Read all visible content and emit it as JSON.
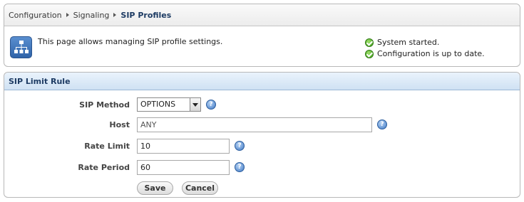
{
  "breadcrumb": {
    "items": [
      "Configuration",
      "Signaling",
      "SIP Profiles"
    ]
  },
  "info": {
    "description": "This page allows managing SIP profile settings.",
    "statuses": [
      "System started.",
      "Configuration is up to date."
    ]
  },
  "icons": {
    "app": "network-hierarchy-icon",
    "status": "check-circle-icon",
    "help": "help-icon",
    "select": "chevron-down-icon"
  },
  "form": {
    "title": "SIP Limit Rule",
    "fields": {
      "sip_method": {
        "label": "SIP Method",
        "value": "OPTIONS",
        "help": "?"
      },
      "host": {
        "label": "Host",
        "value": "ANY",
        "help": "?"
      },
      "rate_limit": {
        "label": "Rate Limit",
        "value": "10",
        "help": "?"
      },
      "rate_period": {
        "label": "Rate Period",
        "value": "60",
        "help": "?"
      }
    },
    "buttons": {
      "save": "Save",
      "cancel": "Cancel"
    }
  },
  "colors": {
    "title_text": "#1d3b63",
    "header_gradient_top": "#eaf3fc",
    "header_gradient_bottom": "#cfe1f3",
    "ok_green": "#3d9a19",
    "help_blue": "#3f78c4"
  }
}
